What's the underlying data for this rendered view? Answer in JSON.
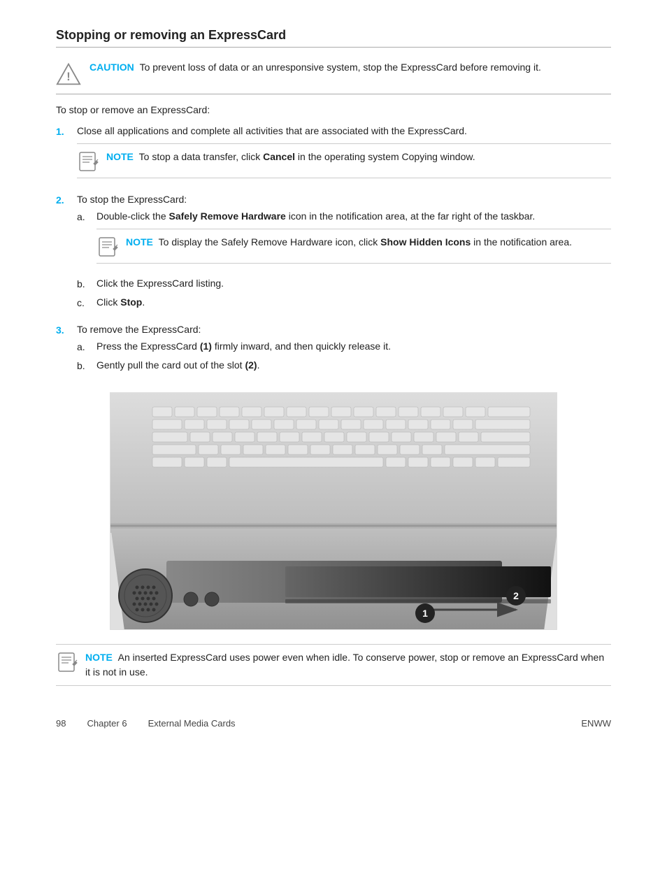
{
  "page": {
    "title": "Stopping or removing an ExpressCard",
    "caution": {
      "label": "CAUTION",
      "text": "To prevent loss of data or an unresponsive system, stop the ExpressCard before removing it."
    },
    "intro": "To stop or remove an ExpressCard:",
    "steps": [
      {
        "num": "1.",
        "text": "Close all applications and complete all activities that are associated with the ExpressCard.",
        "note": {
          "label": "NOTE",
          "text": "To stop a data transfer, click Cancel in the operating system Copying window.",
          "bold_word": "Cancel"
        }
      },
      {
        "num": "2.",
        "text": "To stop the ExpressCard:",
        "sub_steps": [
          {
            "label": "a.",
            "text_before": "Double-click the ",
            "bold": "Safely Remove Hardware",
            "text_after": " icon in the notification area, at the far right of the taskbar.",
            "note": {
              "label": "NOTE",
              "text_before": "To display the Safely Remove Hardware icon, click ",
              "bold": "Show Hidden Icons",
              "text_after": " in the notification area."
            }
          },
          {
            "label": "b.",
            "text": "Click the ExpressCard listing."
          },
          {
            "label": "c.",
            "text_before": "Click ",
            "bold": "Stop",
            "text_after": "."
          }
        ]
      },
      {
        "num": "3.",
        "text": "To remove the ExpressCard:",
        "sub_steps": [
          {
            "label": "a.",
            "text_before": "Press the ExpressCard ",
            "bold": "(1)",
            "text_after": " firmly inward, and then quickly release it."
          },
          {
            "label": "b.",
            "text_before": "Gently pull the card out of the slot ",
            "bold": "(2)",
            "text_after": "."
          }
        ]
      }
    ],
    "bottom_note": {
      "label": "NOTE",
      "text": "An inserted ExpressCard uses power even when idle. To conserve power, stop or remove an ExpressCard when it is not in use."
    },
    "footer": {
      "page_num": "98",
      "chapter": "Chapter 6",
      "chapter_title": "External Media Cards",
      "edition": "ENWW"
    }
  }
}
